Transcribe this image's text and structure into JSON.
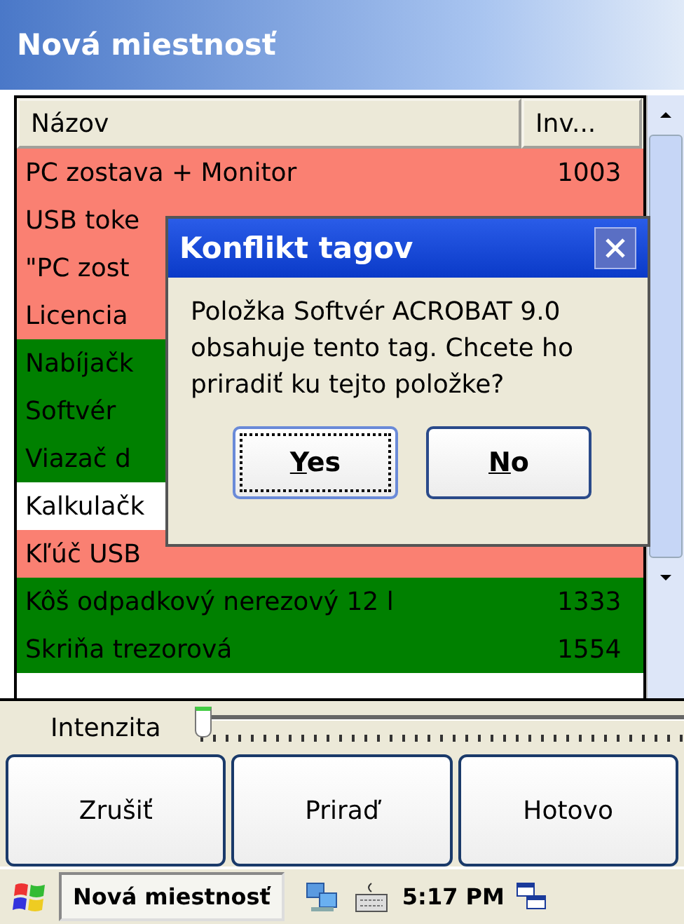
{
  "window": {
    "title": "Nová miestnosť"
  },
  "table": {
    "columns": [
      "Názov",
      "Inv..."
    ],
    "rows": [
      {
        "name": "PC zostava + Monitor",
        "inv": "1003",
        "color": "#fa8072"
      },
      {
        "name": "USB toke",
        "inv": "",
        "color": "#fa8072"
      },
      {
        "name": "\"PC zost",
        "inv": "",
        "color": "#fa8072"
      },
      {
        "name": "Licencia",
        "inv": "",
        "color": "#fa8072"
      },
      {
        "name": "Nabíjačk",
        "inv": "",
        "color": "#008000"
      },
      {
        "name": "Softvér",
        "inv": "",
        "color": "#008000"
      },
      {
        "name": "Viazač d",
        "inv": "",
        "color": "#008000"
      },
      {
        "name": "Kalkulačk",
        "inv": "",
        "color": "#ffffff"
      },
      {
        "name": "Kľúč USB",
        "inv": "",
        "color": "#fa8072"
      },
      {
        "name": "Kôš odpadkový nerezový 12 l",
        "inv": "1333",
        "color": "#008000"
      },
      {
        "name": "Skriňa trezorová",
        "inv": "1554",
        "color": "#008000"
      }
    ]
  },
  "dialog": {
    "title": "Konflikt tagov",
    "message": "Položka Softvér ACROBAT 9.0 obsahuje tento tag. Chcete ho priradiť ku tejto položke?",
    "buttons": [
      {
        "label": "Yes",
        "selected": true
      },
      {
        "label": "No",
        "selected": false
      }
    ]
  },
  "slider": {
    "label": "Intenzita",
    "level": 0
  },
  "buttons": [
    "Zrušiť",
    "Priraď",
    "Hotovo"
  ],
  "taskbar": {
    "app": "Nová miestnosť",
    "time": "5:17 PM"
  }
}
